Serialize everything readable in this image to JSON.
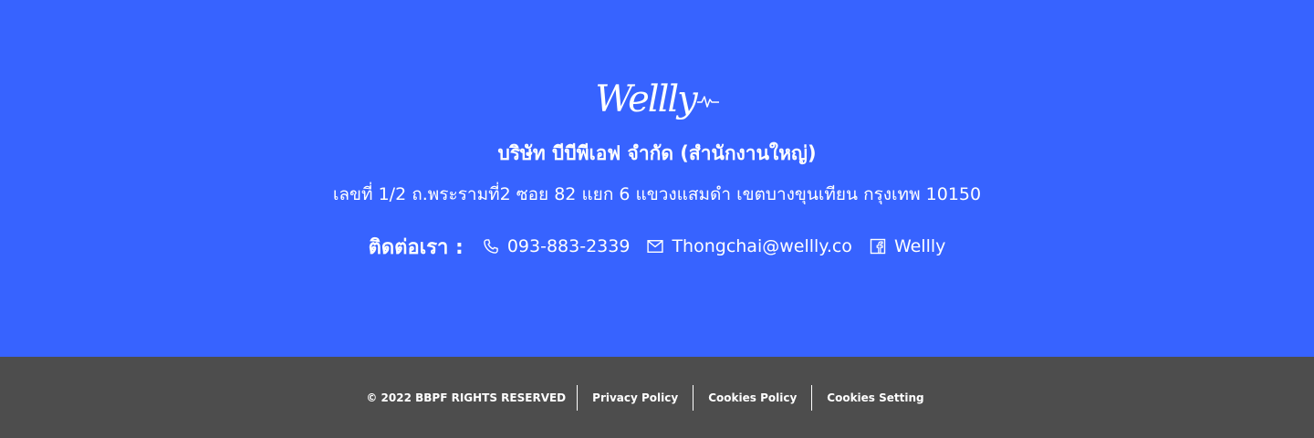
{
  "colors": {
    "top_background": "#3763FF",
    "bottom_background": "#4D4D4D",
    "text": "#FFFFFF"
  },
  "brand": {
    "logo_text": "Wellly"
  },
  "company": {
    "name": "บริษัท บีบีพีเอฟ จำกัด (สำนักงานใหญ่)",
    "address": "เลขที่ 1/2 ถ.พระรามที่2 ซอย 82 แยก 6 แขวงแสมดำ เขตบางขุนเทียน กรุงเทพ 10150"
  },
  "contact": {
    "label": "ติดต่อเรา :",
    "phone": {
      "icon": "phone-icon",
      "text": "093-883-2339"
    },
    "email": {
      "icon": "mail-icon",
      "text": "Thongchai@wellly.co"
    },
    "facebook": {
      "icon": "facebook-icon",
      "text": "Wellly"
    }
  },
  "footer": {
    "copyright": "© 2022 BBPF RIGHTS RESERVED",
    "links": [
      "Privacy Policy",
      "Cookies Policy",
      "Cookies Setting"
    ]
  }
}
